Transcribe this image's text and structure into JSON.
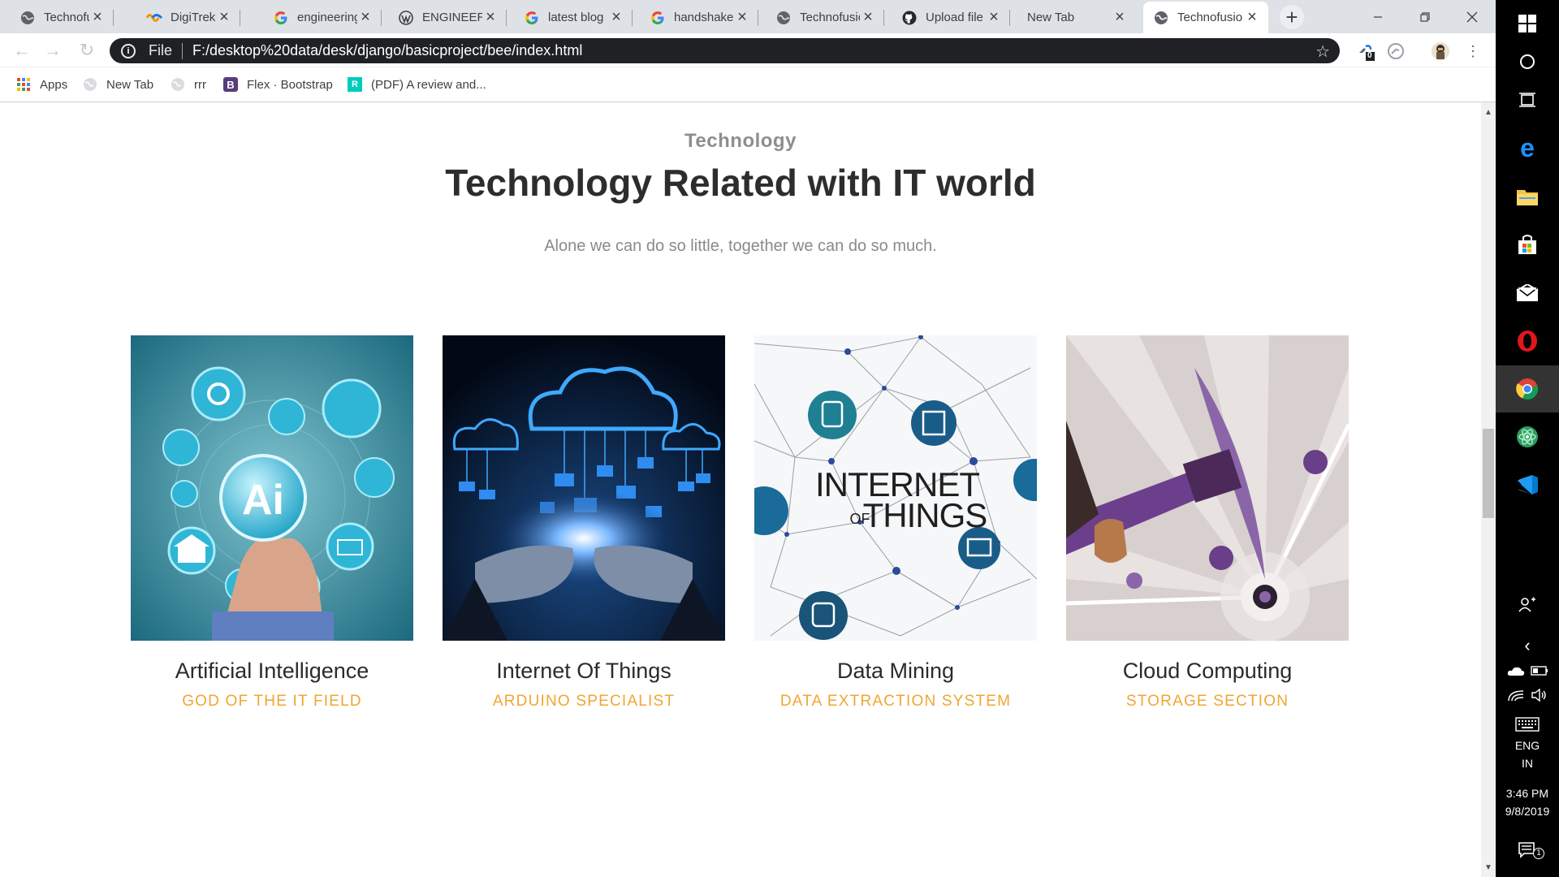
{
  "browser": {
    "tabs": [
      {
        "title": "Technofusion",
        "icon": "globe-icon"
      },
      {
        "title": "DigiTrek - A",
        "icon": "digitrek-icon"
      },
      {
        "title": "engineering",
        "icon": "google-icon"
      },
      {
        "title": "ENGINEERI",
        "icon": "wordpress-icon"
      },
      {
        "title": "latest blog",
        "icon": "google-icon"
      },
      {
        "title": "handshake",
        "icon": "google-icon"
      },
      {
        "title": "Technofusio",
        "icon": "globe-icon"
      },
      {
        "title": "Upload file",
        "icon": "github-icon"
      },
      {
        "title": "New Tab",
        "icon": ""
      },
      {
        "title": "Technofusio",
        "icon": "globe-icon"
      }
    ],
    "active_tab_index": 9,
    "address": {
      "scheme": "File",
      "url": "F:/desktop%20data/desk/django/basicproject/bee/index.html"
    },
    "extension_badge": "0",
    "bookmarks": [
      {
        "label": "Apps",
        "icon": "apps-grid-icon"
      },
      {
        "label": "New Tab",
        "icon": "globe-icon"
      },
      {
        "label": "rrr",
        "icon": "globe-icon"
      },
      {
        "label": "Flex · Bootstrap",
        "icon": "bootstrap-icon"
      },
      {
        "label": "(PDF) A review and...",
        "icon": "researchgate-icon"
      }
    ]
  },
  "page": {
    "section_label": "Technology",
    "section_title": "Technology Related with IT world",
    "section_lead": "Alone we can do so little, together we can do so much.",
    "cards": [
      {
        "title": "Artificial Intelligence",
        "subtitle": "GOD OF THE IT FIELD"
      },
      {
        "title": "Internet Of Things",
        "subtitle": "ARDUINO SPECIALIST"
      },
      {
        "title": "Data Mining",
        "subtitle": "DATA EXTRACTION SYSTEM"
      },
      {
        "title": "Cloud Computing",
        "subtitle": "STORAGE SECTION"
      }
    ],
    "image_text": {
      "ai_badge": "Ai",
      "iot_line1": "INTERNET",
      "iot_of": "OF",
      "iot_line2": "THINGS"
    }
  },
  "taskbar": {
    "language_line1": "ENG",
    "language_line2": "IN",
    "time": "3:46 PM",
    "date": "9/8/2019",
    "notification_count": "1"
  },
  "colors": {
    "accent": "#f2a531",
    "heading": "#2d2d2d",
    "omnibox_bg": "#202124"
  }
}
